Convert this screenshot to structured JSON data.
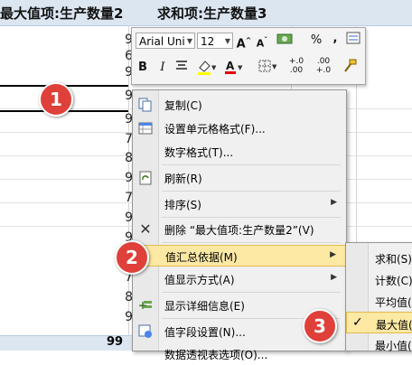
{
  "sheet": {
    "header_left": "最大值项:生产数量2",
    "header_right": "求和项:生产数量3",
    "column_values": [
      "9",
      "6",
      "9",
      "9",
      "9",
      "7",
      "8",
      "9",
      "7",
      "9",
      "9",
      "9",
      "7",
      "8",
      "9",
      "9",
      "8",
      "9"
    ],
    "bottom_value": "99"
  },
  "mini_toolbar": {
    "font_name": "Arial Uni",
    "font_size": "12",
    "grow_font_icon": "A^",
    "shrink_font_icon": "Aˇ",
    "currency_icon": "¥",
    "percent_label": "%",
    "comma_label": ",",
    "bold_label": "B",
    "italic_label": "I",
    "font_color_label": "A",
    "inc_decimal_label": "+.0",
    "dec_decimal_label": ".00",
    "inc_decimal_sub": ".00",
    "dec_decimal_sub": "+.0",
    "highlight_color": "#ffff00",
    "font_color": "#e00000"
  },
  "context_menu": {
    "items": [
      {
        "label": "复制(C)",
        "icon": "copy-icon"
      },
      {
        "label": "设置单元格格式(F)...",
        "icon": "format-cells-icon"
      },
      {
        "label": "数字格式(T)...",
        "icon": ""
      },
      {
        "label": "刷新(R)",
        "icon": "refresh-icon"
      },
      {
        "label": "排序(S)",
        "icon": ""
      },
      {
        "label": "删除 “最大值项:生产数量2”(V)",
        "icon": "delete-icon"
      },
      {
        "label": "值汇总依据(M)",
        "icon": ""
      },
      {
        "label": "值显示方式(A)",
        "icon": ""
      },
      {
        "label": "显示详细信息(E)",
        "icon": "show-details-icon"
      },
      {
        "label": "值字段设置(N)...",
        "icon": "field-settings-icon"
      },
      {
        "label": "数据透视表选项(O)...",
        "icon": ""
      }
    ]
  },
  "submenu": {
    "items": [
      {
        "label": "求和(S)",
        "checked": false
      },
      {
        "label": "计数(C)",
        "checked": false
      },
      {
        "label": "平均值(A)",
        "checked": false
      },
      {
        "label": "最大值(M)",
        "checked": true
      },
      {
        "label": "最小值(I)",
        "checked": false
      }
    ],
    "check_mark": "✓"
  },
  "badges": {
    "one": "1",
    "two": "2",
    "three": "3"
  }
}
